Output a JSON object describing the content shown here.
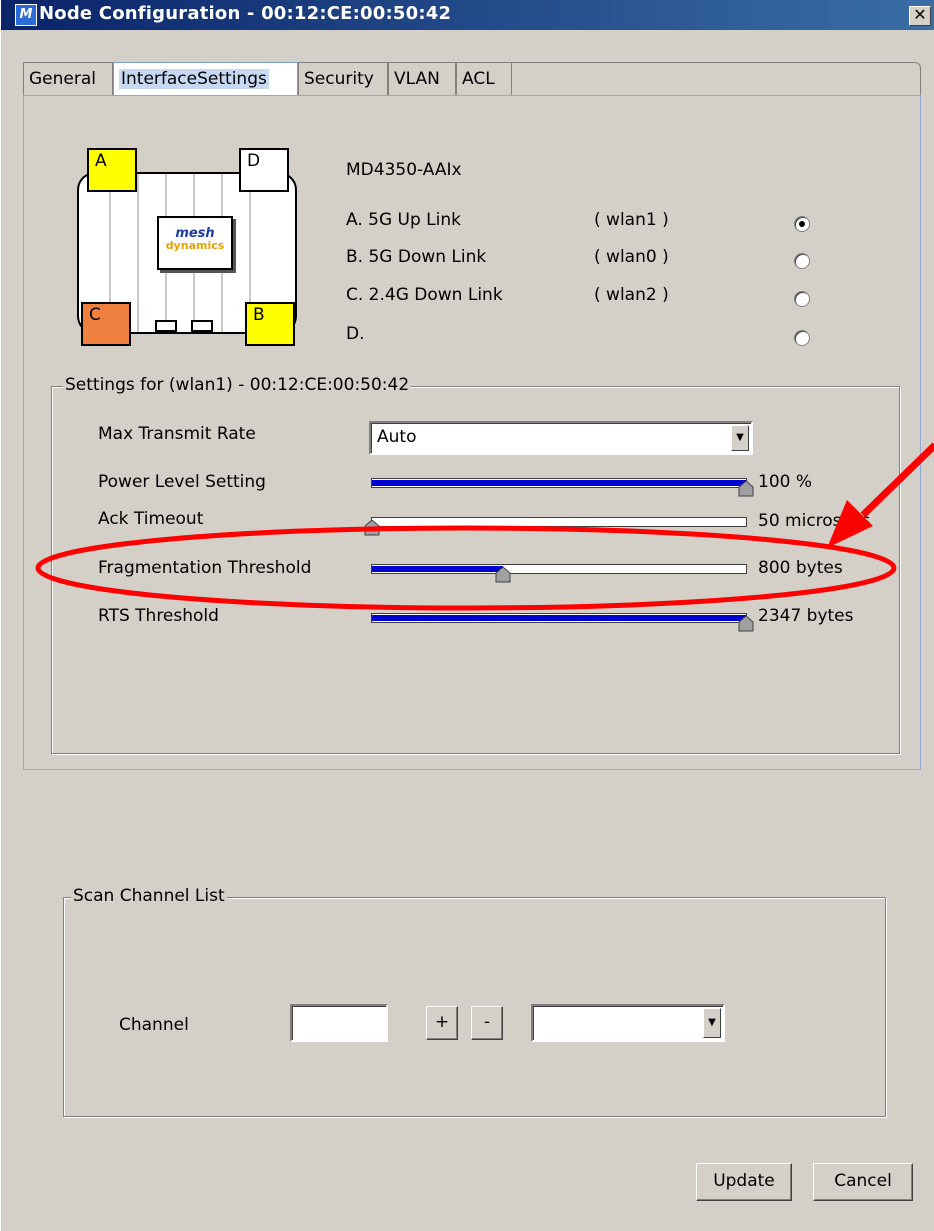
{
  "window": {
    "title": "Node Configuration - 00:12:CE:00:50:42",
    "close_glyph": "✕"
  },
  "tabs": [
    "General",
    "InterfaceSettings",
    "Security",
    "VLAN",
    "ACL"
  ],
  "device": {
    "model": "MD4350-AAIx",
    "ports": {
      "a": "A",
      "b": "B",
      "c": "C",
      "d": "D"
    },
    "port_colors": {
      "a": "#ffff00",
      "b": "#ffff00",
      "c": "#f08040",
      "d": "#ffffff"
    },
    "logo_top": "mesh",
    "logo_bottom": "dynamics"
  },
  "interfaces": [
    {
      "label": "A. 5G  Up Link",
      "wlan": "( wlan1 )",
      "selected": true
    },
    {
      "label": "B. 5G  Down Link",
      "wlan": "( wlan0 )",
      "selected": false
    },
    {
      "label": "C. 2.4G  Down Link",
      "wlan": "( wlan2 )",
      "selected": false
    },
    {
      "label": "D.",
      "wlan": "",
      "selected": false
    }
  ],
  "settings": {
    "legend": "Settings for (wlan1) - 00:12:CE:00:50:42",
    "max_transmit_rate": {
      "label": "Max Transmit Rate",
      "value": "Auto"
    },
    "power_level": {
      "label": "Power Level Setting",
      "value": "100 %",
      "fraction": 1.0
    },
    "ack_timeout": {
      "label": "Ack Timeout",
      "value": "50 microsecs",
      "fraction": 0.0
    },
    "fragmentation": {
      "label": "Fragmentation Threshold",
      "value": "800 bytes",
      "fraction": 0.35
    },
    "rts": {
      "label": "RTS Threshold",
      "value": "2347 bytes",
      "fraction": 1.0
    }
  },
  "scan": {
    "legend": "Scan Channel List",
    "channel_label": "Channel",
    "channel_value": "",
    "add_label": "+",
    "remove_label": "-",
    "list_value": ""
  },
  "buttons": {
    "update": "Update",
    "cancel": "Cancel"
  },
  "annotation_color": "#ff0000"
}
